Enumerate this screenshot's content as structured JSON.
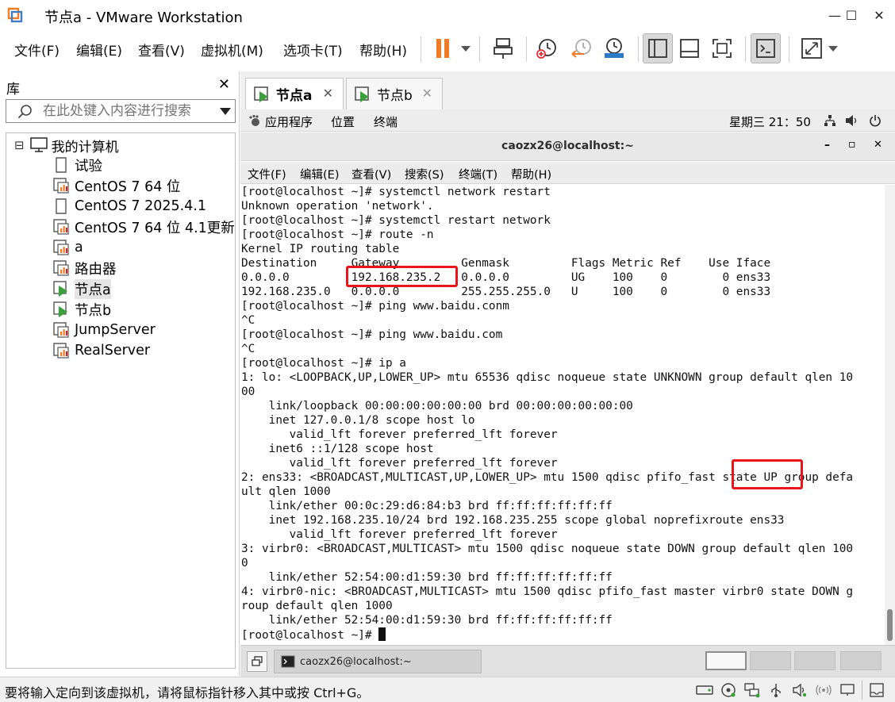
{
  "window": {
    "title": "节点a - VMware Workstation",
    "minimize_glyph": "—",
    "maximize_glyph": "☐",
    "close_glyph": "✕"
  },
  "menu": {
    "file": "文件(F)",
    "edit": "编辑(E)",
    "view": "查看(V)",
    "vm": "虚拟机(M)",
    "tabs": "选项卡(T)",
    "help": "帮助(H)"
  },
  "toolbar": {
    "accent": "#f07c28",
    "icons": [
      "pause-icon",
      "send-keys-icon",
      "snapshot-icon",
      "revert-snapshot-icon",
      "snapshot-manager-icon",
      "library-view-icon",
      "thumbnail-view-icon",
      "fit-guest-icon",
      "console-view-icon",
      "fullscreen-icon"
    ]
  },
  "library": {
    "title": "库",
    "close_glyph": "✕",
    "search_placeholder": "在此处键入内容进行搜索",
    "root_label": "我的计算机",
    "expander": "⊟",
    "items": [
      {
        "label": "试验",
        "type": "blank"
      },
      {
        "label": "CentOS 7 64 位",
        "type": "vm"
      },
      {
        "label": "CentOS 7 2025.4.1",
        "type": "blank"
      },
      {
        "label": "CentOS 7 64 位 4.1更新",
        "type": "vm"
      },
      {
        "label": "a",
        "type": "vm"
      },
      {
        "label": "路由器",
        "type": "vm"
      },
      {
        "label": "节点a",
        "type": "running",
        "selected": true
      },
      {
        "label": "节点b",
        "type": "running"
      },
      {
        "label": "JumpServer",
        "type": "vm"
      },
      {
        "label": "RealServer",
        "type": "vm"
      }
    ]
  },
  "tabs": [
    {
      "label": "节点a",
      "active": true
    },
    {
      "label": "节点b",
      "active": false
    }
  ],
  "guest": {
    "panel": {
      "apps": "应用程序",
      "places": "位置",
      "terminal": "终端",
      "clock": "星期三 21：50"
    },
    "terminal_window": {
      "title": "caozx26@localhost:~",
      "minimize_glyph": "–",
      "maximize_glyph": "▫",
      "close_glyph": "✕"
    },
    "terminal_menu": [
      "文件(F)",
      "编辑(E)",
      "查看(V)",
      "搜索(S)",
      "终端(T)",
      "帮助(H)"
    ],
    "terminal_lines": [
      "[root@localhost ~]# systemctl network restart",
      "Unknown operation 'network'.",
      "[root@localhost ~]# systemctl restart network",
      "[root@localhost ~]# route -n",
      "Kernel IP routing table",
      "Destination     Gateway         Genmask         Flags Metric Ref    Use Iface",
      "0.0.0.0         192.168.235.2   0.0.0.0         UG    100    0        0 ens33",
      "192.168.235.0   0.0.0.0         255.255.255.0   U     100    0        0 ens33",
      "[root@localhost ~]# ping www.baidu.conm",
      "^C",
      "[root@localhost ~]# ping www.baidu.com",
      "^C",
      "[root@localhost ~]# ip a",
      "1: lo: <LOOPBACK,UP,LOWER_UP> mtu 65536 qdisc noqueue state UNKNOWN group default qlen 10",
      "00",
      "    link/loopback 00:00:00:00:00:00 brd 00:00:00:00:00:00",
      "    inet 127.0.0.1/8 scope host lo",
      "       valid_lft forever preferred_lft forever",
      "    inet6 ::1/128 scope host",
      "       valid_lft forever preferred_lft forever",
      "2: ens33: <BROADCAST,MULTICAST,UP,LOWER_UP> mtu 1500 qdisc pfifo_fast state UP group defa",
      "ult qlen 1000",
      "    link/ether 00:0c:29:d6:84:b3 brd ff:ff:ff:ff:ff:ff",
      "    inet 192.168.235.10/24 brd 192.168.235.255 scope global noprefixroute ens33",
      "       valid_lft forever preferred_lft forever",
      "3: virbr0: <BROADCAST,MULTICAST> mtu 1500 qdisc noqueue state DOWN group default qlen 100",
      "0",
      "    link/ether 52:54:00:d1:59:30 brd ff:ff:ff:ff:ff:ff",
      "4: virbr0-nic: <BROADCAST,MULTICAST> mtu 1500 qdisc pfifo_fast master virbr0 state DOWN g",
      "roup default qlen 1000",
      "    link/ether 52:54:00:d1:59:30 brd ff:ff:ff:ff:ff:ff"
    ],
    "prompt": "[root@localhost ~]# ",
    "highlight_color": "#e8151b",
    "taskbar_window": "caozx26@localhost:~"
  },
  "statusbar": {
    "message": "要将输入定向到该虚拟机，请将鼠标指针移入其中或按 Ctrl+G。",
    "icons": [
      "hdd-icon",
      "cdrom-icon",
      "network-icon",
      "usb-icon",
      "sound-icon",
      "printer-icon",
      "display-icon",
      "message-icon"
    ]
  }
}
